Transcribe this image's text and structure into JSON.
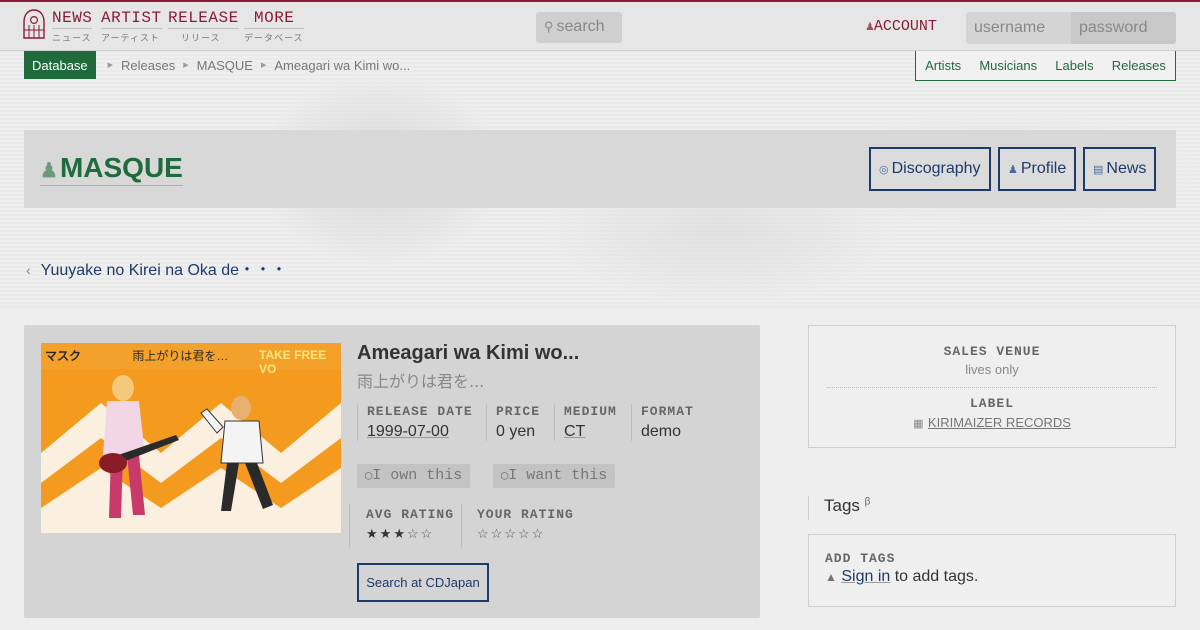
{
  "nav": {
    "items": [
      {
        "en": "NEWS",
        "jp": "ニュース"
      },
      {
        "en": "ARTIST",
        "jp": "アーティスト"
      },
      {
        "en": "RELEASE",
        "jp": "リリース"
      },
      {
        "en": "MORE",
        "jp": "データベース"
      }
    ],
    "search_placeholder": "search",
    "account_label": "ACCOUNT",
    "username_placeholder": "username",
    "password_placeholder": "password",
    "logo_icon": "cage-logo-icon",
    "accent_color": "#8a1c3a"
  },
  "breadcrumb": {
    "root": "Database",
    "items": [
      "Releases",
      "MASQUE",
      "Ameagari wa Kimi wo..."
    ]
  },
  "db_links": [
    "Artists",
    "Musicians",
    "Labels",
    "Releases"
  ],
  "artist": {
    "name": "MASQUE",
    "buttons": [
      {
        "label": "Discography",
        "icon": "disc-icon"
      },
      {
        "label": "Profile",
        "icon": "person-icon"
      },
      {
        "label": "News",
        "icon": "newspaper-icon"
      }
    ],
    "brand_color": "#1f6b3c"
  },
  "prev_release": "Yuuyake no Kirei na Oka de・・・",
  "release": {
    "title": "Ameagari wa Kimi wo...",
    "title_jp": "雨上がりは君を...",
    "cover": {
      "band_artist": "マスク",
      "band_title": "雨上がりは君を…",
      "take_free": "TAKE FREE VO"
    },
    "meta": [
      {
        "label": "RELEASE DATE",
        "value": "1999-07-00"
      },
      {
        "label": "PRICE",
        "value": "0 yen"
      },
      {
        "label": "MEDIUM",
        "value": "CT"
      },
      {
        "label": "FORMAT",
        "value": "demo"
      }
    ],
    "own_label": "I own this",
    "want_label": "I want this",
    "avg_rating_label": "AVG RATING",
    "avg_rating": 3,
    "your_rating_label": "YOUR RATING",
    "your_rating": 0,
    "rating_max": 5,
    "cdjapan_label": "Search at CDJapan"
  },
  "sidebar": {
    "venue_label": "SALES VENUE",
    "venue_value": "lives only",
    "label_label": "LABEL",
    "label_value": "KIRIMAIZER RECORDS",
    "tags_title": "Tags",
    "tags_beta": "β",
    "add_tags_label": "ADD TAGS",
    "sign_in": "Sign in",
    "sign_in_suffix": "to add tags."
  }
}
